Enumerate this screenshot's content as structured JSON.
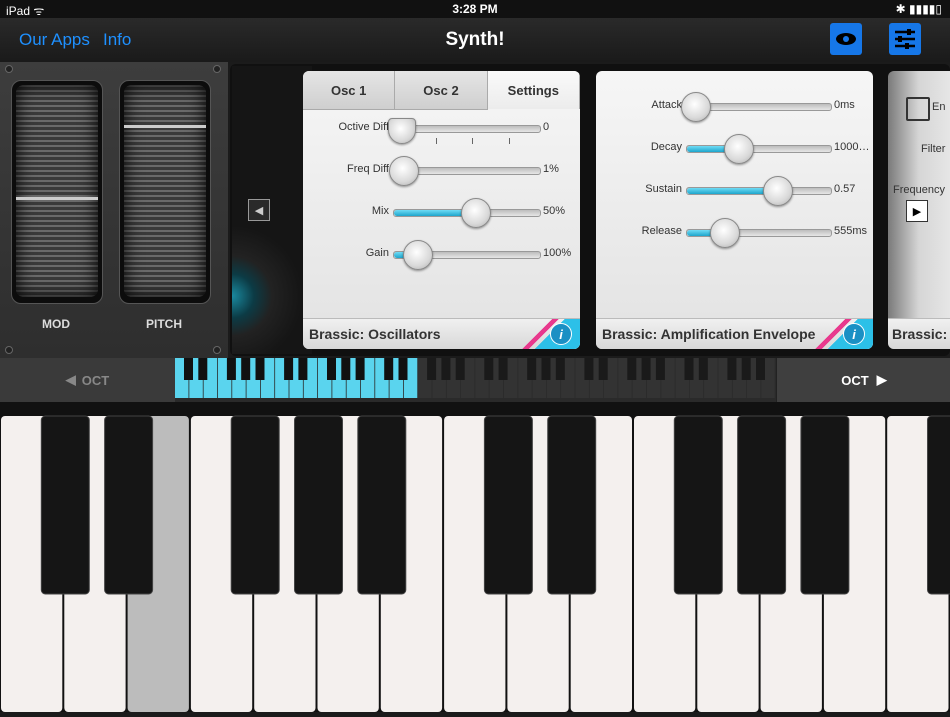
{
  "status": {
    "device": "iPad",
    "time": "3:28 PM"
  },
  "nav": {
    "our_apps": "Our Apps",
    "info": "Info",
    "title": "Synth!",
    "view_icon": "eye-icon",
    "settings_icon": "sliders-icon"
  },
  "wheels": {
    "mod_label": "MOD",
    "pitch_label": "PITCH"
  },
  "osc_card": {
    "tabs": [
      "Osc 1",
      "Osc 2",
      "Settings"
    ],
    "selected_tab": "Settings",
    "title": "Brassic: Oscillators",
    "rows": [
      {
        "label": "Octive Diff",
        "value": "0",
        "fraction": 0.0,
        "kind": "stepped"
      },
      {
        "label": "Freq Diff",
        "value": "1%",
        "fraction": 0.01
      },
      {
        "label": "Mix",
        "value": "50%",
        "fraction": 0.5
      },
      {
        "label": "Gain",
        "value": "100%",
        "fraction": 0.1
      }
    ]
  },
  "amp_card": {
    "title": "Brassic: Amplification Envelope",
    "rows": [
      {
        "label": "Attack",
        "value": "0ms",
        "fraction": 0.0
      },
      {
        "label": "Decay",
        "value": "1000…",
        "fraction": 0.3
      },
      {
        "label": "Sustain",
        "value": "0.57",
        "fraction": 0.57
      },
      {
        "label": "Release",
        "value": "555ms",
        "fraction": 0.2
      }
    ]
  },
  "peek_card": {
    "title": "Brassic:",
    "labels": [
      "En",
      "Filter",
      "Frequency"
    ]
  },
  "octave": {
    "down": "OCT",
    "up": "OCT"
  },
  "colors": {
    "accent": "#1677e8",
    "slider_fill": "#2cc0e8",
    "stripe_pink": "#e8398d"
  }
}
